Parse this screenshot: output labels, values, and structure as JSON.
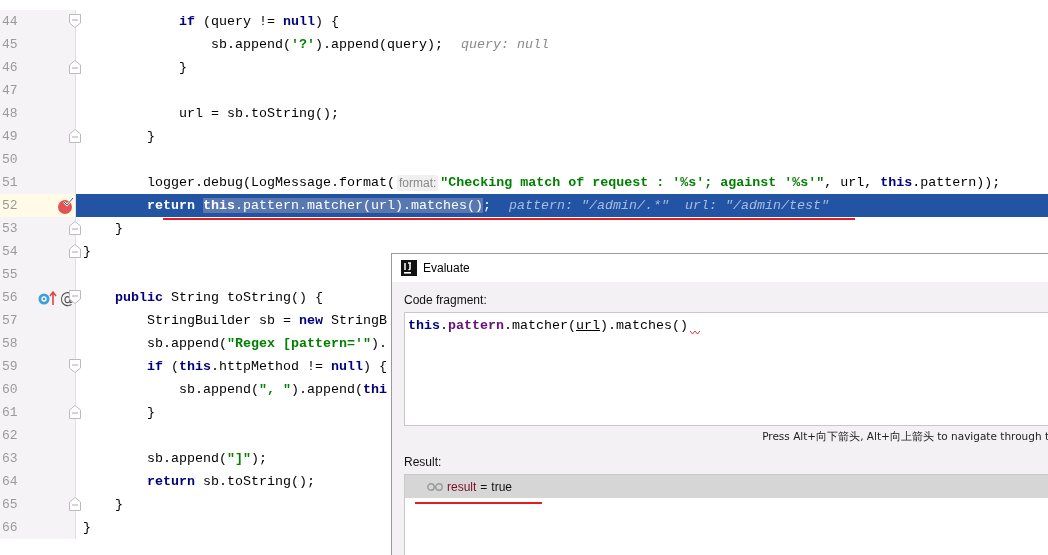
{
  "editor": {
    "lines": [
      {
        "kind": "group",
        "children": [
          {
            "kind": "group",
            "children": [
              {
                "kind": "group",
                "children": [
                  {
                    "num": "44",
                    "kind": "block-start",
                    "tokens": [
                      {
                        "kind": "kw",
                        "t": "if"
                      },
                      {
                        "kind": "plain",
                        "t": " (query != "
                      },
                      {
                        "kind": "kw",
                        "t": "null"
                      },
                      {
                        "kind": "plain",
                        "t": ") {"
                      }
                    ],
                    "children": [
                      {
                        "num": "45",
                        "kind": "plain",
                        "tokens": [
                          {
                            "kind": "plain",
                            "t": "sb.append("
                          },
                          {
                            "kind": "str",
                            "t": "'?'"
                          },
                          {
                            "kind": "plain",
                            "t": ").append(query);"
                          },
                          {
                            "kind": "value",
                            "t": "query: null"
                          }
                        ]
                      }
                    ]
                  },
                  {
                    "num": "46",
                    "kind": "block-end",
                    "tokens": [
                      {
                        "kind": "plain",
                        "t": "}"
                      }
                    ]
                  },
                  {
                    "num": "47",
                    "kind": "plain"
                  },
                  {
                    "num": "48",
                    "kind": "plain",
                    "tokens": [
                      {
                        "kind": "plain",
                        "t": "url = sb.toString();"
                      }
                    ]
                  }
                ]
              },
              {
                "num": "49",
                "kind": "block-end",
                "tokens": [
                  {
                    "kind": "plain",
                    "t": "}"
                  }
                ]
              },
              {
                "num": "50",
                "kind": "plain"
              },
              {
                "num": "51",
                "kind": "plain",
                "tokens": [
                  {
                    "kind": "plain",
                    "t": "logger.debug(LogMessage.format("
                  },
                  {
                    "kind": "hint",
                    "t": "format:"
                  },
                  {
                    "kind": "str",
                    "t": "\"Checking match of request : '%s'; against '%s'\""
                  },
                  {
                    "kind": "plain",
                    "t": ", url, "
                  },
                  {
                    "kind": "kw",
                    "t": "this"
                  },
                  {
                    "kind": "plain",
                    "t": ".pattern));"
                  }
                ]
              },
              {
                "num": "52",
                "kind": "plain",
                "current": true,
                "annotated": true,
                "breakpoint": true,
                "tokens": [
                  {
                    "kind": "kw",
                    "t": "return ",
                    "selected": false
                  },
                  {
                    "kind": "kw",
                    "t": "this",
                    "selected": true
                  },
                  {
                    "kind": "plain",
                    "t": ".pattern.matcher(url).matches()",
                    "selected": true
                  },
                  {
                    "kind": "plain",
                    "t": ";",
                    "selected": false
                  },
                  {
                    "kind": "value",
                    "t": "pattern: \"/admin/.*\"  url: \"/admin/test\"",
                    "selected": false
                  }
                ]
              }
            ]
          },
          {
            "num": "53",
            "kind": "block-end",
            "tokens": [
              {
                "kind": "plain",
                "t": "}"
              }
            ]
          }
        ]
      },
      {
        "num": "54",
        "kind": "block-end",
        "tokens": [
          {
            "kind": "plain",
            "t": "}"
          }
        ]
      },
      {
        "num": "55",
        "kind": "plain"
      },
      {
        "kind": "group",
        "children": [
          {
            "num": "56",
            "kind": "block-start",
            "overridden": true,
            "gutter_text": "@",
            "tokens": [
              {
                "kind": "kw",
                "t": "public"
              },
              {
                "kind": "plain",
                "t": " String toString() {"
              }
            ],
            "children": [
              {
                "num": "57",
                "kind": "plain",
                "tokens": [
                  {
                    "kind": "plain",
                    "t": "StringBuilder sb = "
                  },
                  {
                    "kind": "kw",
                    "t": "new"
                  },
                  {
                    "kind": "plain",
                    "t": " StringB"
                  }
                ]
              },
              {
                "num": "58",
                "kind": "plain",
                "tokens": [
                  {
                    "kind": "plain",
                    "t": "sb.append("
                  },
                  {
                    "kind": "str",
                    "t": "\"Regex [pattern='\""
                  },
                  {
                    "kind": "plain",
                    "t": ")."
                  }
                ]
              },
              {
                "num": "59",
                "kind": "block-start",
                "tokens": [
                  {
                    "kind": "kw",
                    "t": "if"
                  },
                  {
                    "kind": "plain",
                    "t": " ("
                  },
                  {
                    "kind": "kw",
                    "t": "this"
                  },
                  {
                    "kind": "plain",
                    "t": ".httpMethod != "
                  },
                  {
                    "kind": "kw",
                    "t": "null"
                  },
                  {
                    "kind": "plain",
                    "t": ") {"
                  }
                ],
                "children": [
                  {
                    "num": "60",
                    "kind": "plain",
                    "tokens": [
                      {
                        "kind": "plain",
                        "t": "sb.append("
                      },
                      {
                        "kind": "str",
                        "t": "\", \""
                      },
                      {
                        "kind": "plain",
                        "t": ").append("
                      },
                      {
                        "kind": "kw",
                        "t": "thi"
                      }
                    ]
                  }
                ]
              },
              {
                "num": "61",
                "kind": "block-end",
                "tokens": [
                  {
                    "kind": "plain",
                    "t": "}"
                  }
                ]
              },
              {
                "num": "62",
                "kind": "plain"
              },
              {
                "num": "63",
                "kind": "plain",
                "tokens": [
                  {
                    "kind": "plain",
                    "t": "sb.append("
                  },
                  {
                    "kind": "str",
                    "t": "\"]\""
                  },
                  {
                    "kind": "plain",
                    "t": ");"
                  }
                ]
              },
              {
                "num": "64",
                "kind": "plain",
                "tokens": [
                  {
                    "kind": "kw",
                    "t": "return"
                  },
                  {
                    "kind": "plain",
                    "t": " sb.toString();"
                  }
                ]
              }
            ]
          },
          {
            "num": "65",
            "kind": "block-end",
            "tokens": [
              {
                "kind": "plain",
                "t": "}"
              }
            ]
          }
        ]
      },
      {
        "num": "66",
        "kind": "plain",
        "tokens": [
          {
            "kind": "plain",
            "t": "}"
          }
        ]
      }
    ]
  },
  "dialog": {
    "title": "Evaluate",
    "fragment_label": "Code fragment:",
    "fragment": {
      "error": true,
      "tokens": [
        {
          "kind": "kw",
          "t": "this"
        },
        {
          "kind": "plain",
          "t": "."
        },
        {
          "kind": "field",
          "t": "pattern"
        },
        {
          "kind": "plain",
          "t": ".matcher("
        },
        {
          "kind": "param",
          "t": "url"
        },
        {
          "kind": "plain",
          "t": ").matches()"
        }
      ]
    },
    "hint": "Press Alt+向下箭头, Alt+向上箭头 to navigate through t",
    "result_label": "Result:",
    "result": {
      "name": "result",
      "sep": "=",
      "value": "true",
      "annotated": true
    }
  }
}
